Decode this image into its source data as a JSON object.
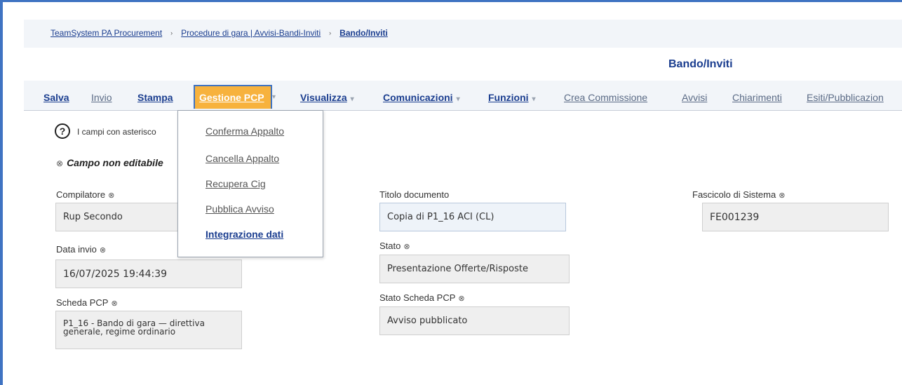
{
  "breadcrumb": {
    "items": [
      "TeamSystem PA Procurement",
      "Procedure di gara | Avvisi-Bandi-Inviti",
      "Bando/Inviti"
    ],
    "separator": "›"
  },
  "header": {
    "title": "Bando/Inviti"
  },
  "toolbar": {
    "items": [
      {
        "label": "Salva"
      },
      {
        "label": "Invio"
      },
      {
        "label": "Stampa"
      },
      {
        "label": "Gestione PCP",
        "active": true
      },
      {
        "label": "Visualizza"
      },
      {
        "label": "Comunicazioni"
      },
      {
        "label": "Funzioni"
      },
      {
        "label": "Crea Commissione"
      },
      {
        "label": "Avvisi"
      },
      {
        "label": "Chiarimenti"
      },
      {
        "label": "Esiti/Pubblicazion"
      }
    ],
    "caret": "▾"
  },
  "dropdown": {
    "items": [
      {
        "label": "Conferma Appalto"
      },
      {
        "label": "Cancella Appalto"
      },
      {
        "label": "Recupera Cig"
      },
      {
        "label": "Pubblica Avviso"
      },
      {
        "label": "Integrazione dati"
      }
    ]
  },
  "info": {
    "help_icon": "?",
    "help_text": "I campi con asterisco",
    "non_editable_note": "Campo non editabile",
    "non_editable_icon": "⊗"
  },
  "fields": {
    "compilatore": {
      "label": "Compilatore",
      "value": "Rup Secondo"
    },
    "data_invio": {
      "label": "Data invio",
      "value": "16/07/2025 19:44:39"
    },
    "scheda_pcp": {
      "label": "Scheda PCP",
      "value": "P1_16 - Bando di gara — direttiva generale, regime ordinario"
    },
    "titolo_documento": {
      "label": "Titolo documento",
      "value": "Copia di P1_16 ACI (CL)"
    },
    "stato": {
      "label": "Stato",
      "value": "Presentazione Offerte/Risposte"
    },
    "stato_scheda_pcp": {
      "label": "Stato Scheda PCP",
      "value": "Avviso pubblicato"
    },
    "fascicolo_di_sistema": {
      "label": "Fascicolo di Sistema",
      "value": "FE001239"
    }
  },
  "colors": {
    "accent_blue": "#3f73c2",
    "link_blue": "#1a3d8f",
    "active_menu_orange": "#f7b23d"
  }
}
